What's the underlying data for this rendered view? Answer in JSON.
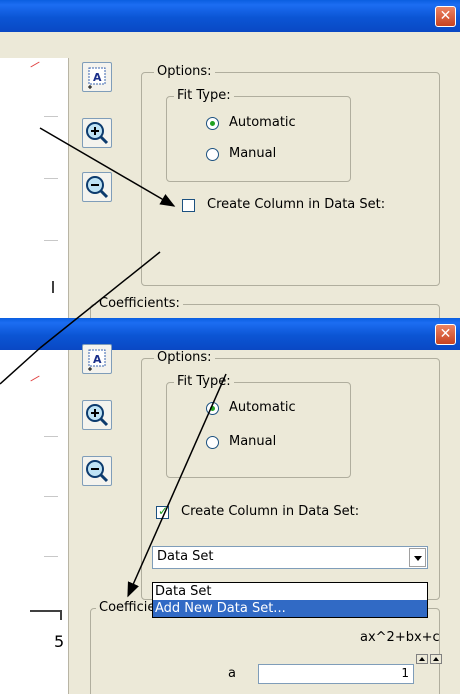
{
  "window_top": {
    "options_title": "Options:",
    "fit_type_title": "Fit Type:",
    "radio_automatic": "Automatic",
    "radio_manual": "Manual",
    "create_column_label": "Create Column in Data Set:",
    "create_column_checked": false,
    "coefficients_title": "Coefficients:"
  },
  "window_bottom": {
    "options_title": "Options:",
    "fit_type_title": "Fit Type:",
    "radio_automatic": "Automatic",
    "radio_manual": "Manual",
    "create_column_label": "Create Column in Data Set:",
    "create_column_checked": true,
    "dataset_combo_value": "Data Set",
    "dropdown_options": [
      "Data Set",
      "Add New Data Set..."
    ],
    "dropdown_selected": "Add New Data Set...",
    "coefficients_title": "Coefficients:",
    "formula": "ax^2+bx+c",
    "coefficient_value": "1",
    "axis_tick_label": "5"
  },
  "icons": {
    "close": "close-icon",
    "text": "text-tool-icon",
    "zoom_in": "zoom-in-icon",
    "zoom_out": "zoom-out-icon"
  },
  "colors": {
    "titlebar": "#0a55d4",
    "close_button": "#d65a36",
    "dialog_bg": "#ece9d8",
    "selection": "#316ac5",
    "radio_dot": "#21a121"
  }
}
